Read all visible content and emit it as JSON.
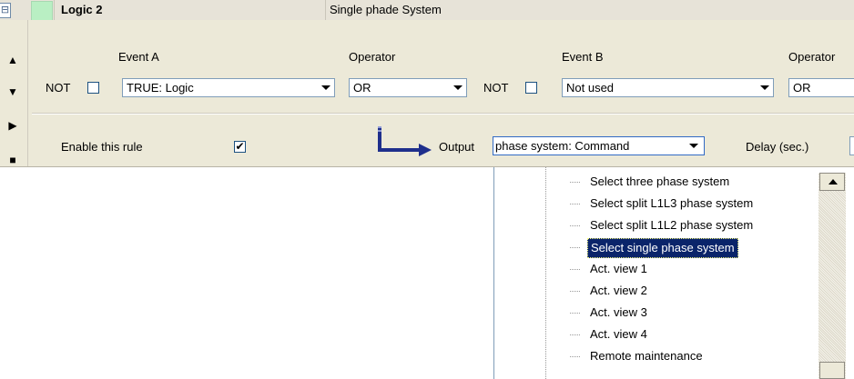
{
  "header": {
    "collapse_glyph": "⊟",
    "logic_name": "Logic 2",
    "system_name": "Single phade System",
    "swatch_color": "#b9efc3"
  },
  "nav": {
    "up": "▲",
    "down": "▼",
    "play": "▶",
    "stop": "■"
  },
  "row1": {
    "event_a_label": "Event A",
    "operator1_label": "Operator",
    "event_b_label": "Event B",
    "operator2_label": "Operator",
    "not1_label": "NOT",
    "not2_label": "NOT",
    "event_a_value": "TRUE: Logic",
    "operator1_value": "OR",
    "event_b_value": "Not used",
    "operator2_value": "OR"
  },
  "row2": {
    "enable_label": "Enable this rule",
    "enable_checked": "✔",
    "output_label": "Output",
    "output_value": "phase system: Command",
    "delay_label": "Delay (sec.)"
  },
  "dropdown": {
    "items": [
      "Select three phase system",
      "Select split L1L3 phase system",
      "Select split L1L2 phase system",
      "Select single phase system",
      "Act. view 1",
      "Act. view 2",
      "Act. view 3",
      "Act. view 4",
      "Remote maintenance"
    ],
    "selected_index": 3
  }
}
